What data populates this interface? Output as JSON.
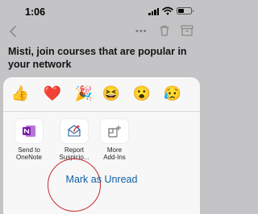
{
  "status_bar": {
    "time": "1:06",
    "battery_level": 0.45,
    "icons": [
      "signal-icon",
      "wifi-icon",
      "battery-icon"
    ]
  },
  "mail_header": {
    "icons": [
      "back-icon",
      "more-icon",
      "trash-icon",
      "archive-icon"
    ]
  },
  "email": {
    "subject": "Misti, join courses that are popular in your network"
  },
  "reactions": {
    "items": [
      {
        "name": "thumbs-up",
        "glyph": "👍"
      },
      {
        "name": "heart",
        "glyph": "❤️"
      },
      {
        "name": "party",
        "glyph": "🎉"
      },
      {
        "name": "laugh",
        "glyph": "😆"
      },
      {
        "name": "surprised",
        "glyph": "😮"
      },
      {
        "name": "sad",
        "glyph": "😥"
      }
    ]
  },
  "addins": {
    "items": [
      {
        "line1": "Send to",
        "line2": "OneNote",
        "icon": "onenote-icon"
      },
      {
        "line1": "Report",
        "line2": "Suspicio...",
        "icon": "report-phishing-icon"
      },
      {
        "line1": "More",
        "line2": "Add-Ins",
        "icon": "add-ins-icon"
      }
    ]
  },
  "actions": {
    "mark_unread": "Mark as Unread"
  },
  "colors": {
    "accent": "#0f5fa6",
    "highlight_circle": "#c42b2b",
    "onenote": "#7719aa"
  }
}
